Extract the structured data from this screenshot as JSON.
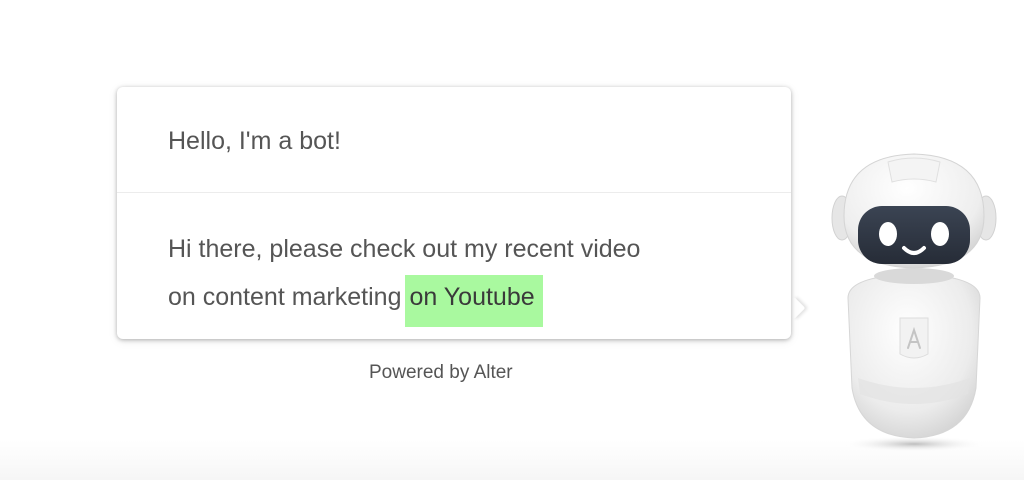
{
  "chat": {
    "bot_greeting": "Hello, I'm a bot!",
    "message_line1": "Hi there, please check out my recent video",
    "message_line2_prefix": "on content marketing",
    "message_link": "on Youtube",
    "link_highlight_color": "#a9f99f"
  },
  "footer": {
    "powered_by": "Powered by Alter"
  },
  "robot": {
    "icon": "robot-mascot-icon",
    "chest_logo": "A"
  }
}
